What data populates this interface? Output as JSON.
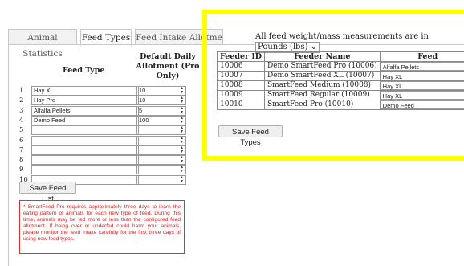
{
  "tabs": [
    {
      "label": "Animal Statistics"
    },
    {
      "label": "Feed Types"
    },
    {
      "label": "Feed Intake Allotme"
    }
  ],
  "feed_types": {
    "header_feed_type": "Feed Type",
    "header_allot": "Default Daily Allotment (Pro Only)",
    "rows": [
      {
        "num": "1",
        "name": "Hay XL",
        "qty": "10"
      },
      {
        "num": "2",
        "name": "Hay Pro",
        "qty": "10"
      },
      {
        "num": "3",
        "name": "Alfalfa Pellets",
        "qty": "5"
      },
      {
        "num": "4",
        "name": "Demo Feed",
        "qty": "100"
      },
      {
        "num": "5",
        "name": "",
        "qty": ""
      },
      {
        "num": "6",
        "name": "",
        "qty": ""
      },
      {
        "num": "7",
        "name": "",
        "qty": ""
      },
      {
        "num": "8",
        "name": "",
        "qty": ""
      },
      {
        "num": "9",
        "name": "",
        "qty": ""
      },
      {
        "num": "10",
        "name": "",
        "qty": ""
      }
    ],
    "save_button": "Save Feed List",
    "note": "* SmartFeed Pro requires approximately three days to learn the eating pattern of animals for each new type of feed. During this time, animals may be fed more or less than the configured feed allotment. If being over or underfed could harm your animals, please monitor the feed intake carefully for the first three days of using new feed types."
  },
  "measurement": {
    "text": "All feed weight/mass measurements are in",
    "unit": "Pounds (lbs)"
  },
  "feeders": {
    "headers": [
      "Feeder ID",
      "Feeder Name",
      "Feed"
    ],
    "rows": [
      {
        "id": "10006",
        "name": "Demo SmartFeed Pro (10006)",
        "feed": "Alfalfa Pellets"
      },
      {
        "id": "10007",
        "name": "Demo SmartFeed XL (10007)",
        "feed": "Hay XL"
      },
      {
        "id": "10008",
        "name": "SmartFeed Medium (10008)",
        "feed": "Hay XL"
      },
      {
        "id": "10009",
        "name": "SmartFeed Regular (10009)",
        "feed": "Hay XL"
      },
      {
        "id": "10010",
        "name": "SmartFeed Pro (10010)",
        "feed": "Demo Feed"
      }
    ],
    "save_button": "Save Feed Types"
  },
  "colors": {
    "highlight": "#ffff00",
    "note_red": "#d82020"
  }
}
